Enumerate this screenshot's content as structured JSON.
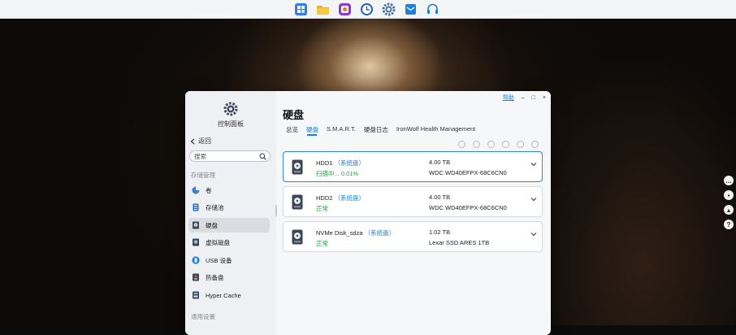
{
  "taskbar": {
    "apps": [
      {
        "name": "app-center",
        "color": "#2f7fe0"
      },
      {
        "name": "file-manager",
        "color": "#f2b21b"
      },
      {
        "name": "photos",
        "color": "#8a3bd6"
      },
      {
        "name": "clock-app",
        "color": "#1d5fc4"
      },
      {
        "name": "control-panel",
        "color": "#4a6fa5"
      },
      {
        "name": "mail-app",
        "color": "#1f7fe0"
      },
      {
        "name": "support-app",
        "color": "#1f7fe0"
      }
    ]
  },
  "window": {
    "controls": {
      "help": "帮助",
      "minimize": "–",
      "maximize": "□",
      "close": "×"
    },
    "sidebar": {
      "app_title": "控制面板",
      "back_label": "返回",
      "search_placeholder": "搜索",
      "section_storage": "存储管理",
      "section_general": "通用设置",
      "items": [
        {
          "label": "卷",
          "icon": "volume-icon"
        },
        {
          "label": "存储池",
          "icon": "storage-pool-icon"
        },
        {
          "label": "硬盘",
          "icon": "hdd-icon",
          "active": true
        },
        {
          "label": "虚拟磁盘",
          "icon": "virtual-disk-icon"
        },
        {
          "label": "USB 设备",
          "icon": "usb-icon"
        },
        {
          "label": "热备盘",
          "icon": "hot-spare-icon"
        },
        {
          "label": "Hyper Cache",
          "icon": "hyper-cache-icon"
        }
      ]
    },
    "main": {
      "title": "硬盘",
      "tabs": [
        {
          "label": "总览"
        },
        {
          "label": "硬盘",
          "active": true
        },
        {
          "label": "S.M.A.R.T."
        },
        {
          "label": "硬盘日志"
        },
        {
          "label": "IronWolf Health Management"
        }
      ],
      "disks": [
        {
          "name": "HDD1",
          "tag": "（系统盘）",
          "status": "扫描中... 0.01%",
          "capacity": "4.00 TB",
          "model": "WDC WD40EFPX-68C6CN0",
          "selected": true
        },
        {
          "name": "HDD2",
          "tag": "（系统盘）",
          "status": "正常",
          "capacity": "4.00 TB",
          "model": "WDC WD40EFPX-68C6CN0"
        },
        {
          "name": "NVMe Disk_sdza",
          "tag": "（系统盘）",
          "status": "正常",
          "capacity": "1.02 TB",
          "model": "Lexar SSD ARES 1TB"
        }
      ]
    }
  },
  "side_buttons": [
    "chat-icon",
    "message-icon",
    "bell-icon",
    "help-icon"
  ],
  "colors": {
    "accent": "#1e7fd8",
    "ok": "#20a140"
  }
}
